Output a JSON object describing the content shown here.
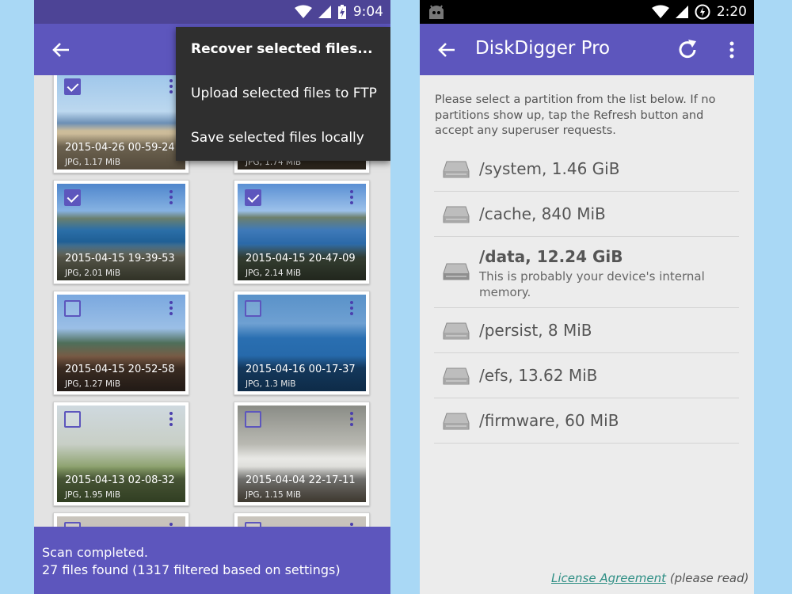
{
  "left_phone": {
    "status": {
      "time": "9:04"
    },
    "menu": {
      "items": [
        "Recover selected files...",
        "Upload selected files to FTP",
        "Save selected files locally"
      ]
    },
    "photos": [
      {
        "date": "2015-04-26 00-59-24",
        "info": "JPG, 1.17 MiB",
        "checked": true,
        "scene": "beach"
      },
      {
        "date": "",
        "info": "JPG, 1.74 MiB",
        "checked": false,
        "scene": "beach2"
      },
      {
        "date": "2015-04-15 19-39-53",
        "info": "JPG, 2.01 MiB",
        "checked": true,
        "scene": "bay"
      },
      {
        "date": "2015-04-15 20-47-09",
        "info": "JPG, 2.14 MiB",
        "checked": true,
        "scene": "bay2"
      },
      {
        "date": "2015-04-15 20-52-58",
        "info": "JPG, 1.27 MiB",
        "checked": false,
        "scene": "selfie"
      },
      {
        "date": "2015-04-16 00-17-37",
        "info": "JPG, 1.3 MiB",
        "checked": false,
        "scene": "table"
      },
      {
        "date": "2015-04-13 02-08-32",
        "info": "JPG, 1.95 MiB",
        "checked": false,
        "scene": "pig"
      },
      {
        "date": "2015-04-04 22-17-11",
        "info": "JPG, 1.15 MiB",
        "checked": false,
        "scene": "dog"
      }
    ],
    "scan_status": {
      "line1": "Scan completed.",
      "line2": "27 files found (1317 filtered based on settings)"
    }
  },
  "right_phone": {
    "status": {
      "time": "2:20"
    },
    "title": "DiskDigger Pro",
    "intro": "Please select a partition from the list below. If no partitions show up, tap the Refresh button and accept any superuser requests.",
    "partitions": [
      {
        "name": "/system, 1.46 GiB",
        "desc": "",
        "bold": false
      },
      {
        "name": "/cache, 840 MiB",
        "desc": "",
        "bold": false
      },
      {
        "name": "/data, 12.24 GiB",
        "desc": "This is probably your device's internal memory.",
        "bold": true
      },
      {
        "name": "/persist, 8 MiB",
        "desc": "",
        "bold": false
      },
      {
        "name": "/efs, 13.62 MiB",
        "desc": "",
        "bold": false
      },
      {
        "name": "/firmware, 60 MiB",
        "desc": "",
        "bold": false
      }
    ],
    "license": {
      "link": "License Agreement",
      "note": "(please read)"
    }
  },
  "colors": {
    "primary": "#5d56bd",
    "status_dark": "#4d4496",
    "background": "#a9d8f5",
    "menu_bg": "#2f2f2f",
    "link": "#2f8f85"
  }
}
